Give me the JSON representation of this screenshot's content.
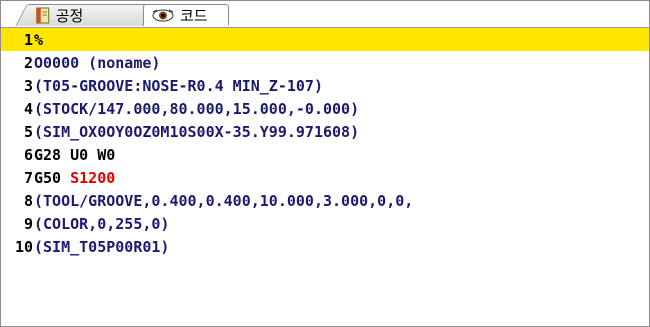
{
  "tabs": [
    {
      "label": "공정",
      "icon": "book-icon",
      "active": false
    },
    {
      "label": "코드",
      "icon": "eye-icon",
      "active": true
    }
  ],
  "editor": {
    "current_line": 1,
    "lines": [
      {
        "num": "1",
        "segments": [
          {
            "text": "%",
            "style": "plain"
          }
        ]
      },
      {
        "num": "2",
        "segments": [
          {
            "text": "O0000 (noname)",
            "style": "comment"
          }
        ]
      },
      {
        "num": "3",
        "segments": [
          {
            "text": "(T05-GROOVE:NOSE-R0.4 MIN_Z-107)",
            "style": "comment"
          }
        ]
      },
      {
        "num": "4",
        "segments": [
          {
            "text": "(STOCK/147.000,80.000,15.000,-0.000)",
            "style": "comment"
          }
        ]
      },
      {
        "num": "5",
        "segments": [
          {
            "text": "(SIM_OX0OY0OZ0M10S00X-35.Y99.971608)",
            "style": "comment"
          }
        ]
      },
      {
        "num": "6",
        "segments": [
          {
            "text": "G28 U0 W0",
            "style": "plain"
          }
        ]
      },
      {
        "num": "7",
        "segments": [
          {
            "text": "G50 ",
            "style": "plain"
          },
          {
            "text": "S1200",
            "style": "red"
          }
        ]
      },
      {
        "num": "8",
        "segments": [
          {
            "text": "(TOOL/GROOVE,0.400,0.400,10.000,3.000,0,0,",
            "style": "comment"
          }
        ]
      },
      {
        "num": "9",
        "segments": [
          {
            "text": "(COLOR,0,255,0)",
            "style": "comment"
          }
        ]
      },
      {
        "num": "10",
        "segments": [
          {
            "text": "(SIM_T05P00R01)",
            "style": "comment"
          }
        ]
      }
    ]
  },
  "colors": {
    "current_line_bg": "#ffe600",
    "comment": "#1a1a6e",
    "value_red": "#e00000"
  }
}
